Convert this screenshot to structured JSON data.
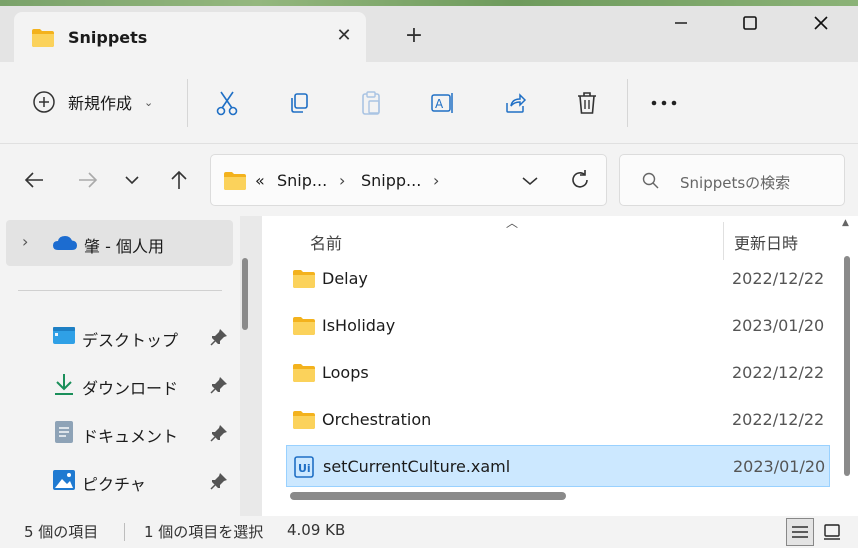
{
  "window": {
    "tab_title": "Snippets",
    "minimize_label": "–",
    "maximize_label": "□",
    "close_label": "✕"
  },
  "toolbar": {
    "new_label": "新規作成"
  },
  "address": {
    "overflow": "«",
    "crumbs": [
      "Snip...",
      "Snipp..."
    ]
  },
  "search": {
    "placeholder": "Snippetsの検索"
  },
  "sidebar": {
    "top_item": "肇 - 個人用",
    "items": [
      {
        "label": "デスクトップ"
      },
      {
        "label": "ダウンロード"
      },
      {
        "label": "ドキュメント"
      },
      {
        "label": "ピクチャ"
      }
    ]
  },
  "columns": {
    "name": "名前",
    "date": "更新日時"
  },
  "files": [
    {
      "name": "Delay",
      "date": "2022/12/22",
      "type": "folder"
    },
    {
      "name": "IsHoliday",
      "date": "2023/01/20",
      "type": "folder"
    },
    {
      "name": "Loops",
      "date": "2022/12/22",
      "type": "folder"
    },
    {
      "name": "Orchestration",
      "date": "2022/12/22",
      "type": "folder"
    },
    {
      "name": "setCurrentCulture.xaml",
      "date": "2023/01/20",
      "type": "uipath",
      "selected": true
    }
  ],
  "status": {
    "count": "5 個の項目",
    "selection": "1 個の項目を選択",
    "size": "4.09 KB"
  },
  "colors": {
    "accent": "#0067c0",
    "selection": "#cce8ff",
    "folder": "#f7c548"
  }
}
